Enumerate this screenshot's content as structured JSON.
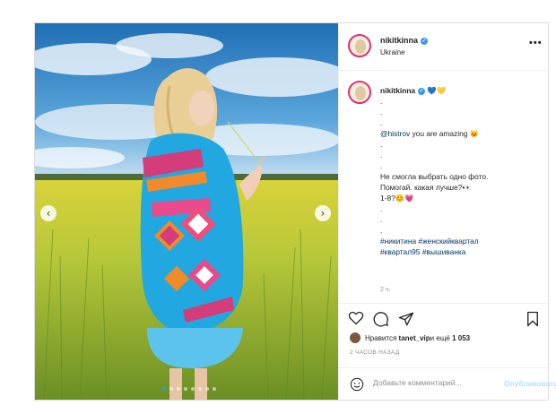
{
  "post": {
    "username": "nikitkinna",
    "location": "Ukraine",
    "more_icon": "more-horizontal-icon",
    "caption_username": "nikitkinna",
    "caption_flags": "💙💛",
    "dots": ".",
    "mention": "@histrov",
    "mention_text": " you are amazing 🐱",
    "line1": "Не смогла выбрать одно фото.",
    "line2": "Помогай. какая лучше?👀",
    "line3": "1-8?😊💗",
    "hashtags1": "#никитина #женскийквартал",
    "hashtags2": "#квартал95 #вышиванка",
    "time_small": "2 ч.",
    "likes_prefix": "Нравится ",
    "likes_user": "tanet_vip",
    "likes_mid": " и ещё ",
    "likes_count": "1 053",
    "ago": "2 ЧАСОВ НАЗАД",
    "comment_placeholder": "Добавьте комментарий...",
    "publish_label": "Опубликовать"
  },
  "colors": {
    "accent": "#3897f0",
    "publish": "#b2dffc"
  },
  "icons": [
    "heart-icon",
    "comment-icon",
    "share-icon",
    "bookmark-icon",
    "emoji-icon",
    "chevron-left-icon",
    "chevron-right-icon"
  ]
}
